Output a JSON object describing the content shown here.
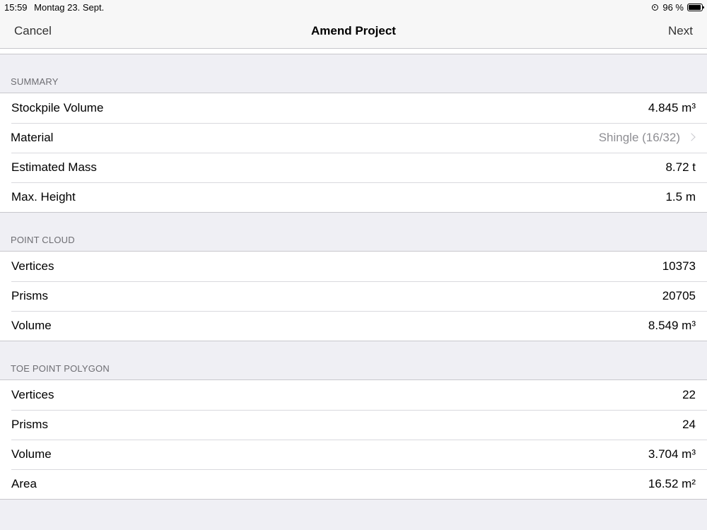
{
  "status_bar": {
    "time": "15:59",
    "date": "Montag 23. Sept.",
    "battery": "96 %",
    "battery_level": 0.96
  },
  "nav": {
    "cancel_label": "Cancel",
    "title": "Amend Project",
    "next_label": "Next"
  },
  "sections": {
    "summary": {
      "header": "SUMMARY",
      "stockpile_volume": {
        "label": "Stockpile Volume",
        "value": "4.845 m³"
      },
      "material": {
        "label": "Material",
        "value": "Shingle (16/32)"
      },
      "estimated_mass": {
        "label": "Estimated Mass",
        "value": "8.72 t"
      },
      "max_height": {
        "label": "Max. Height",
        "value": "1.5 m"
      }
    },
    "point_cloud": {
      "header": "POINT CLOUD",
      "vertices": {
        "label": "Vertices",
        "value": "10373"
      },
      "prisms": {
        "label": "Prisms",
        "value": "20705"
      },
      "volume": {
        "label": "Volume",
        "value": "8.549 m³"
      }
    },
    "toe_point_polygon": {
      "header": "TOE POINT POLYGON",
      "vertices": {
        "label": "Vertices",
        "value": "22"
      },
      "prisms": {
        "label": "Prisms",
        "value": "24"
      },
      "volume": {
        "label": "Volume",
        "value": "3.704 m³"
      },
      "area": {
        "label": "Area",
        "value": "16.52 m²"
      }
    }
  },
  "icons": {
    "orientation_lock": "orientation-lock-icon",
    "battery": "battery-icon",
    "chevron": "chevron-right-icon"
  }
}
